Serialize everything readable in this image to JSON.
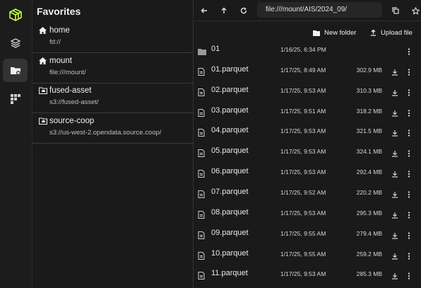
{
  "sidebar": {
    "title": "Favorites",
    "items": [
      {
        "name": "home",
        "path": "fd://",
        "icon": "home-icon"
      },
      {
        "name": "mount",
        "path": "file:///mount/",
        "icon": "home-icon"
      },
      {
        "name": "fused-asset",
        "path": "s3://fused-asset/",
        "icon": "folder-cloud-icon"
      },
      {
        "name": "source-coop",
        "path": "s3://us-west-2.opendata.source.coop/",
        "icon": "folder-cloud-icon"
      }
    ]
  },
  "toolbar": {
    "address": "file:///mount/AIS/2024_09/"
  },
  "actions": {
    "new_folder": "New folder",
    "upload_file": "Upload file"
  },
  "files": [
    {
      "name": "01",
      "date": "1/16/25, 6:34 PM",
      "size": "",
      "type": "folder"
    },
    {
      "name": "01.parquet",
      "date": "1/17/25, 8:49 AM",
      "size": "302.9 MB",
      "type": "file"
    },
    {
      "name": "02.parquet",
      "date": "1/17/25, 9:53 AM",
      "size": "310.3 MB",
      "type": "file"
    },
    {
      "name": "03.parquet",
      "date": "1/17/25, 9:51 AM",
      "size": "318.2 MB",
      "type": "file"
    },
    {
      "name": "04.parquet",
      "date": "1/17/25, 9:53 AM",
      "size": "321.5 MB",
      "type": "file"
    },
    {
      "name": "05.parquet",
      "date": "1/17/25, 9:53 AM",
      "size": "324.1 MB",
      "type": "file"
    },
    {
      "name": "06.parquet",
      "date": "1/17/25, 9:53 AM",
      "size": "292.4 MB",
      "type": "file"
    },
    {
      "name": "07.parquet",
      "date": "1/17/25, 9:52 AM",
      "size": "220.2 MB",
      "type": "file"
    },
    {
      "name": "08.parquet",
      "date": "1/17/25, 9:53 AM",
      "size": "295.3 MB",
      "type": "file"
    },
    {
      "name": "09.parquet",
      "date": "1/17/25, 9:55 AM",
      "size": "279.4 MB",
      "type": "file"
    },
    {
      "name": "10.parquet",
      "date": "1/17/25, 9:55 AM",
      "size": "259.2 MB",
      "type": "file"
    },
    {
      "name": "11.parquet",
      "date": "1/17/25, 9:53 AM",
      "size": "285.3 MB",
      "type": "file"
    }
  ],
  "colors": {
    "accent": "#c5ff3a",
    "background": "#1a1a1a",
    "active_rail": "#333333"
  }
}
